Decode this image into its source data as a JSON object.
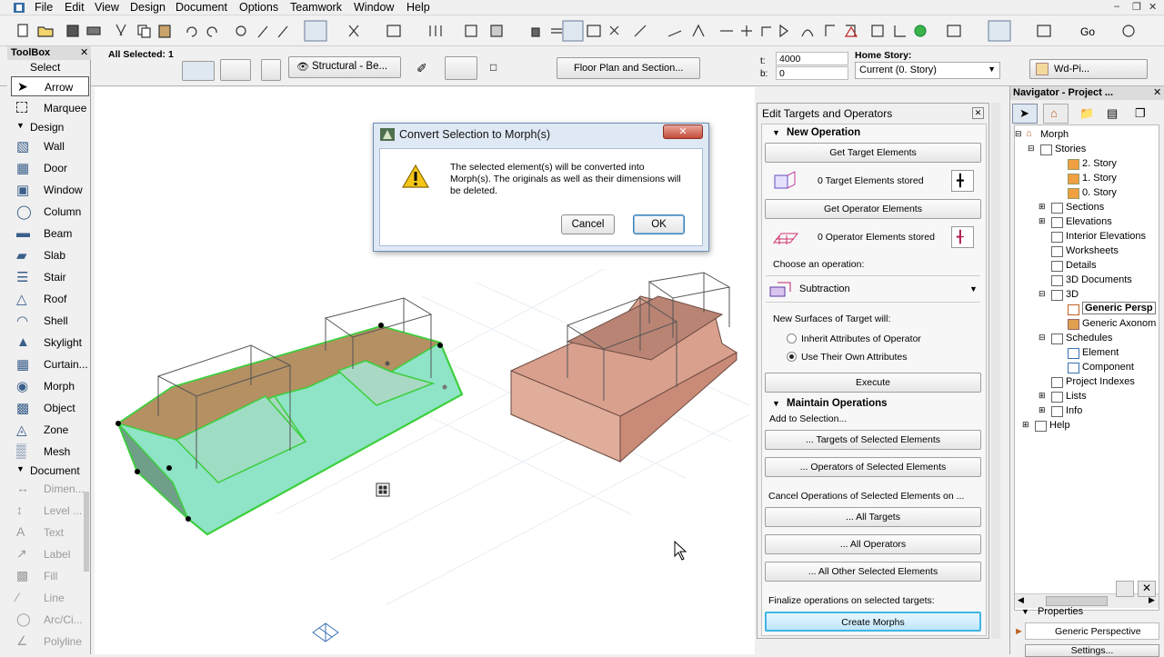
{
  "menubar": {
    "items": [
      "File",
      "Edit",
      "View",
      "Design",
      "Document",
      "Options",
      "Teamwork",
      "Window",
      "Help"
    ]
  },
  "infobox": {
    "selection": "All Selected: 1",
    "layer": "Structural - Be...",
    "floor_plan_btn": "Floor Plan and Section...",
    "t_label": "t:",
    "t_value": "4000",
    "b_label": "b:",
    "b_value": "0",
    "home_story_label": "Home Story:",
    "home_story_value": "Current (0. Story)",
    "pen_label": "Wd-Pi..."
  },
  "toolbox": {
    "title": "ToolBox",
    "select_header": "Select",
    "select_tools": [
      "Arrow",
      "Marquee"
    ],
    "design_header": "Design",
    "design_tools": [
      "Wall",
      "Door",
      "Window",
      "Column",
      "Beam",
      "Slab",
      "Stair",
      "Roof",
      "Shell",
      "Skylight",
      "Curtain...",
      "Morph",
      "Object",
      "Zone",
      "Mesh"
    ],
    "document_header": "Document",
    "document_tools": [
      "Dimen...",
      "Level ...",
      "Text",
      "Label",
      "Fill",
      "Line",
      "Arc/Ci...",
      "Polyline"
    ]
  },
  "dialog": {
    "title": "Convert Selection to Morph(s)",
    "message_line1": "The selected element(s) will be converted into",
    "message_line2": "Morph(s). The originals as well as their dimensions will",
    "message_line3": "be deleted.",
    "cancel": "Cancel",
    "ok": "OK"
  },
  "etpanel": {
    "title": "Edit Targets and Operators",
    "new_operation": "New Operation",
    "get_target": "Get Target Elements",
    "targets_stored": "0  Target Elements stored",
    "get_operator": "Get Operator Elements",
    "operators_stored": "0  Operator Elements stored",
    "choose_op": "Choose an operation:",
    "operation": "Subtraction",
    "new_surfaces": "New Surfaces of Target will:",
    "radio_inherit": "Inherit Attributes of Operator",
    "radio_own": "Use Their Own Attributes",
    "execute": "Execute",
    "maintain": "Maintain Operations",
    "add_to_sel": "Add to Selection...",
    "targets_of_sel": "... Targets of Selected Elements",
    "operators_of_sel": "... Operators of Selected Elements",
    "cancel_ops": "Cancel Operations of Selected Elements on ...",
    "all_targets": "... All Targets",
    "all_operators": "... All Operators",
    "all_other": "... All Other Selected Elements",
    "finalize": "Finalize operations on selected targets:",
    "create_morphs": "Create Morphs"
  },
  "navigator": {
    "title": "Navigator - Project ...",
    "tree": {
      "root": "Morph",
      "stories": "Stories",
      "story2": "2. Story",
      "story1": "1. Story",
      "story0": "0. Story",
      "sections": "Sections",
      "elevations": "Elevations",
      "interior": "Interior Elevations",
      "worksheets": "Worksheets",
      "details": "Details",
      "docs3d": "3D Documents",
      "d3": "3D",
      "generic_persp": "Generic Persp",
      "generic_axon": "Generic Axonom",
      "schedules": "Schedules",
      "element": "Element",
      "component": "Component",
      "project_indexes": "Project Indexes",
      "lists": "Lists",
      "info": "Info",
      "help": "Help"
    },
    "properties_label": "Properties",
    "properties_value": "Generic Perspective",
    "settings_btn": "Settings..."
  },
  "colors": {
    "selection_green": "#3ccf3c",
    "morph_fill": "#d9a08e",
    "accent_blue": "#1f6fd1"
  }
}
